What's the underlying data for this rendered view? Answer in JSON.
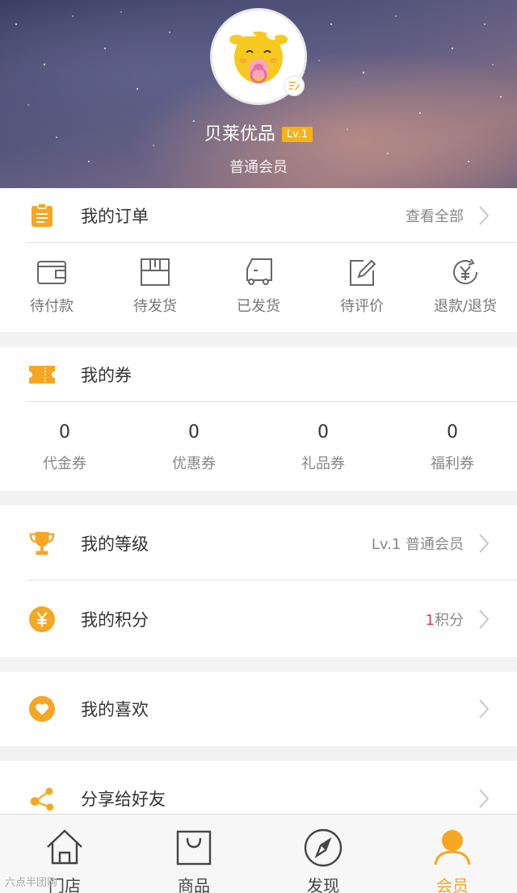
{
  "profile": {
    "name": "贝莱优品",
    "level_badge": "Lv.1",
    "member_type": "普通会员"
  },
  "orders": {
    "title": "我的订单",
    "view_all": "查看全部",
    "statuses": [
      {
        "label": "待付款",
        "icon": "wallet-icon"
      },
      {
        "label": "待发货",
        "icon": "package-icon"
      },
      {
        "label": "已发货",
        "icon": "truck-icon"
      },
      {
        "label": "待评价",
        "icon": "edit-icon"
      },
      {
        "label": "退款/退货",
        "icon": "refund-icon"
      }
    ]
  },
  "coupons": {
    "title": "我的券",
    "items": [
      {
        "count": "0",
        "label": "代金券"
      },
      {
        "count": "0",
        "label": "优惠券"
      },
      {
        "count": "0",
        "label": "礼品券"
      },
      {
        "count": "0",
        "label": "福利券"
      }
    ]
  },
  "level": {
    "title": "我的等级",
    "value": "Lv.1 普通会员"
  },
  "points": {
    "title": "我的积分",
    "count": "1",
    "unit": "积分"
  },
  "favorites": {
    "title": "我的喜欢"
  },
  "share": {
    "title": "分享给好友"
  },
  "tabs": [
    {
      "label": "门店",
      "icon": "home-icon"
    },
    {
      "label": "商品",
      "icon": "bag-icon"
    },
    {
      "label": "发现",
      "icon": "compass-icon"
    },
    {
      "label": "会员",
      "icon": "user-icon"
    }
  ],
  "watermark": "六点半团购",
  "colors": {
    "accent": "#f5a623",
    "points_red": "#e23d3d",
    "level_badge": "#f5b21b"
  }
}
